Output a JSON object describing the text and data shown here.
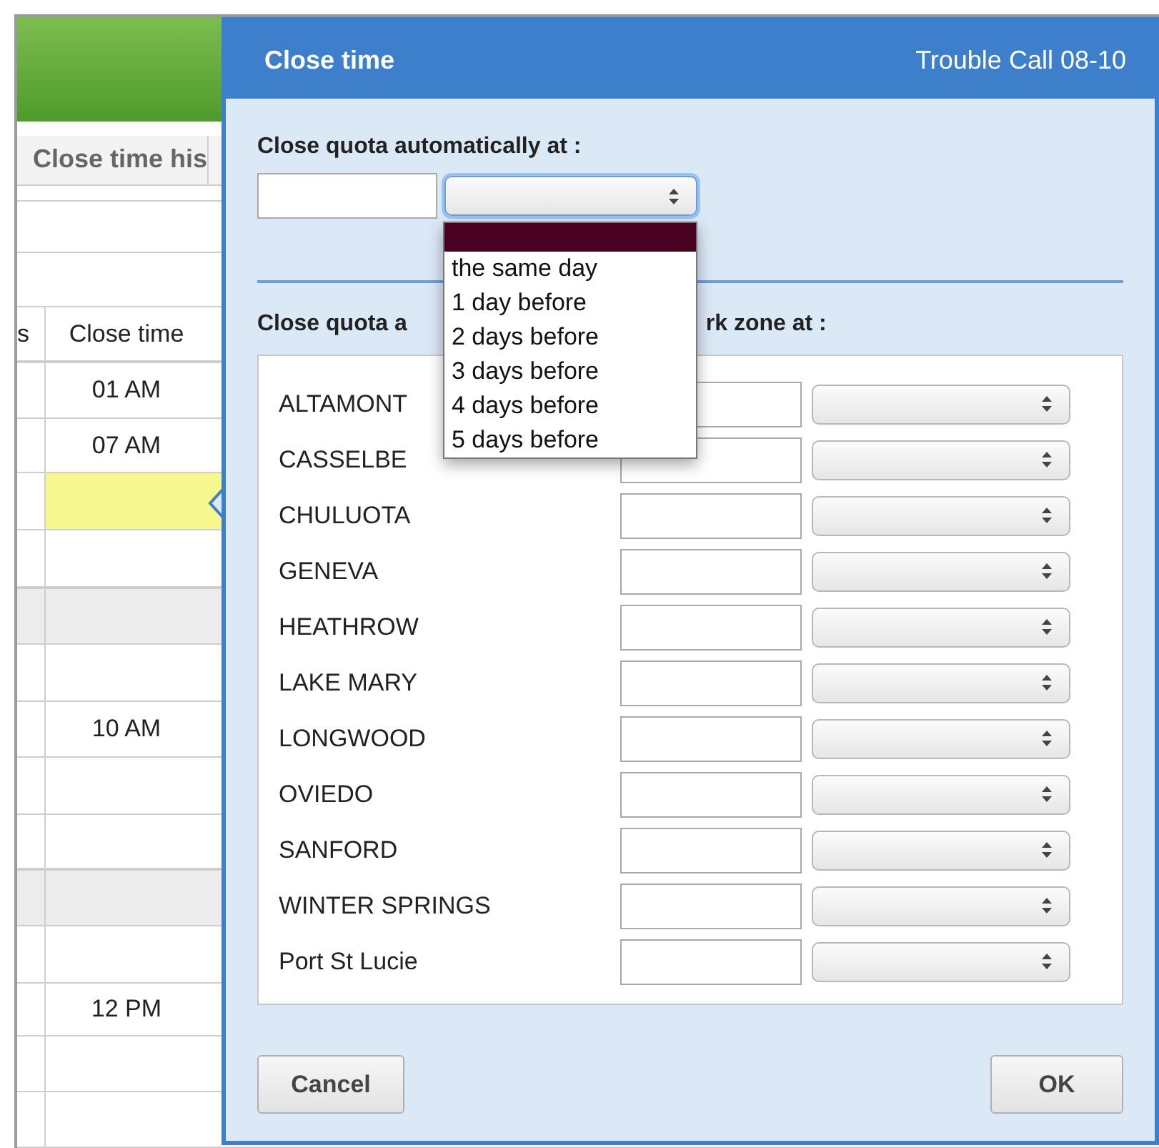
{
  "background": {
    "tab": "Close time his",
    "columns": [
      "s",
      "Close time"
    ],
    "rows": [
      {
        "kind": "plain",
        "time": "01 AM",
        "selected": false
      },
      {
        "kind": "plain",
        "time": "07 AM",
        "selected": false
      },
      {
        "kind": "plain",
        "selected": true
      },
      {
        "kind": "plain",
        "selected": false
      },
      {
        "kind": "group",
        "selected": false
      },
      {
        "kind": "plain",
        "selected": false
      },
      {
        "kind": "plain",
        "time": "10 AM",
        "selected": false
      },
      {
        "kind": "plain",
        "selected": false
      },
      {
        "kind": "plain",
        "selected": false
      },
      {
        "kind": "group",
        "selected": false
      },
      {
        "kind": "plain",
        "selected": false
      },
      {
        "kind": "plain",
        "time": "12 PM",
        "selected": false
      },
      {
        "kind": "plain",
        "selected": false
      },
      {
        "kind": "plain",
        "selected": false
      }
    ]
  },
  "dialog": {
    "title": "Close time",
    "subtitle": "Trouble Call 08-10",
    "auto_label": "Close quota automatically at :",
    "dropdown": {
      "options": [
        {
          "selected": true
        },
        {
          "label": "the same day",
          "selected": false
        },
        {
          "label": "1 day before",
          "selected": false
        },
        {
          "label": "2 days before",
          "selected": false
        },
        {
          "label": "3 days before",
          "selected": false
        },
        {
          "label": "4 days before",
          "selected": false
        },
        {
          "label": "5 days before",
          "selected": false
        }
      ]
    },
    "zone_heading_start": "Close quota a",
    "zone_heading_end": "rk zone at :",
    "zones": [
      {
        "name": "ALTAMONT"
      },
      {
        "name": "CASSELBE"
      },
      {
        "name": "CHULUOTA"
      },
      {
        "name": "GENEVA"
      },
      {
        "name": "HEATHROW"
      },
      {
        "name": "LAKE MARY"
      },
      {
        "name": "LONGWOOD"
      },
      {
        "name": "OVIEDO"
      },
      {
        "name": "SANFORD"
      },
      {
        "name": "WINTER SPRINGS"
      },
      {
        "name": "Port St Lucie"
      }
    ],
    "buttons": {
      "cancel": "Cancel",
      "ok": "OK"
    }
  }
}
